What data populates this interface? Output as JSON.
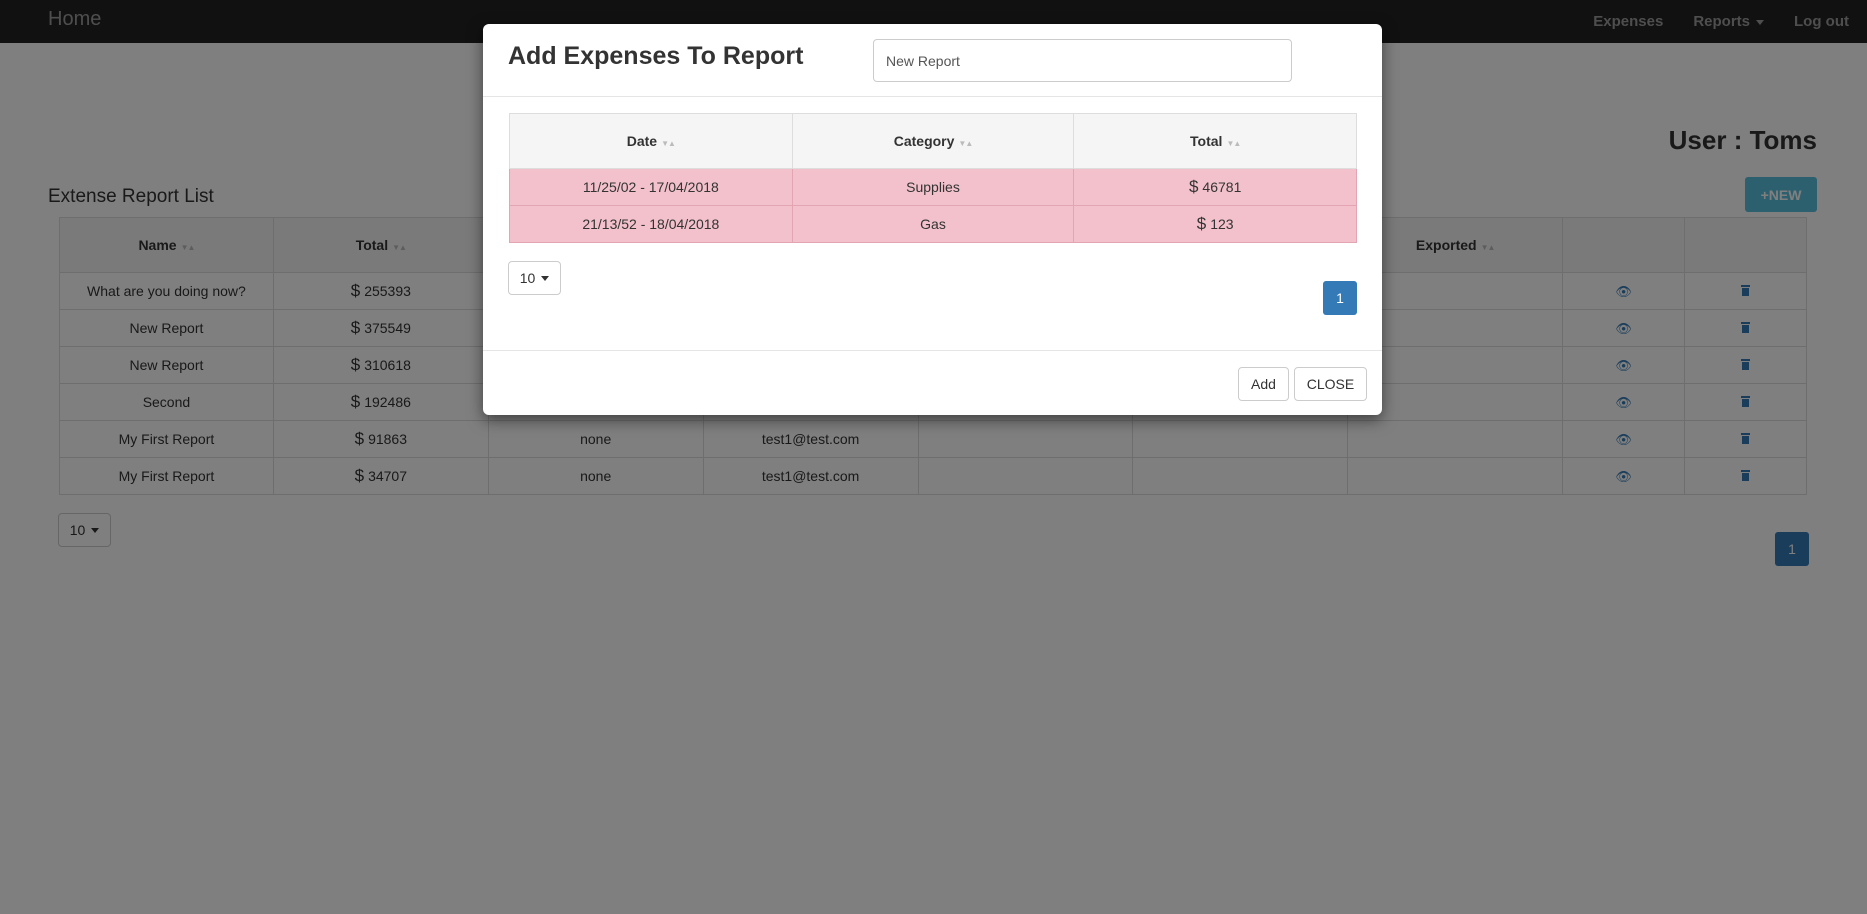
{
  "navbar": {
    "brand": "Home",
    "links": [
      {
        "label": "Expenses"
      },
      {
        "label": "Reports",
        "has_caret": true
      },
      {
        "label": "Log out"
      }
    ]
  },
  "user_label": "User : Toms",
  "report_list": {
    "title": "Extense Report List",
    "new_button": "+NEW",
    "columns": [
      "Name",
      "Total",
      "",
      "",
      "",
      "",
      "Exported",
      "",
      ""
    ],
    "rows": [
      {
        "name": "What are you doing now?",
        "total": "255393",
        "col3": "",
        "col4": ""
      },
      {
        "name": "New Report",
        "total": "375549",
        "col3": "",
        "col4": ""
      },
      {
        "name": "New Report",
        "total": "310618",
        "col3": "",
        "col4": ""
      },
      {
        "name": "Second",
        "total": "192486",
        "col3": "",
        "col4": ""
      },
      {
        "name": "My First Report",
        "total": "91863",
        "col3": "none",
        "col4": "test1@test.com"
      },
      {
        "name": "My First Report",
        "total": "34707",
        "col3": "none",
        "col4": "test1@test.com"
      }
    ],
    "currency_symbol": "$",
    "page_size": "10",
    "current_page": "1"
  },
  "modal": {
    "title": "Add Expenses To Report",
    "report_name_value": "New Report",
    "columns": [
      "Date",
      "Category",
      "Total"
    ],
    "rows": [
      {
        "date": "11/25/02 - 17/04/2018",
        "category": "Supplies",
        "total": "46781"
      },
      {
        "date": "21/13/52 - 18/04/2018",
        "category": "Gas",
        "total": "123"
      }
    ],
    "currency_symbol": "$",
    "page_size": "10",
    "current_page": "1",
    "add_label": "Add",
    "close_label": "CLOSE",
    "highlight_color": "#f2c1cb"
  },
  "colors": {
    "navbar_bg": "#222222",
    "primary": "#337ab7",
    "info": "#5bc0de"
  }
}
